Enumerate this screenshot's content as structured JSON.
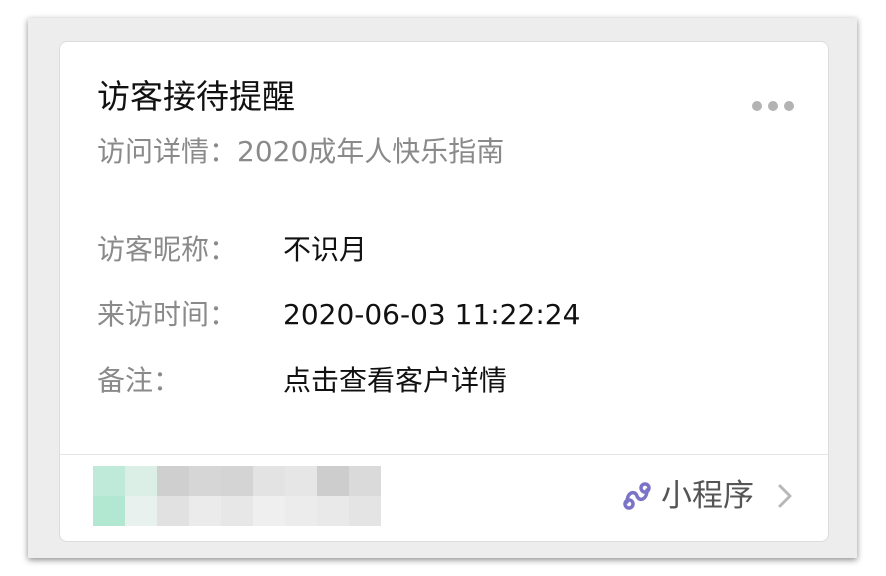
{
  "card": {
    "title": "访客接待提醒",
    "subtitle": "访问详情：2020成年人快乐指南",
    "more_icon": "more-horizontal-icon",
    "fields": [
      {
        "label": "访客昵称：",
        "value": "不识月"
      },
      {
        "label": "来访时间：",
        "value": "2020-06-03 11:22:24"
      },
      {
        "label": "备注：",
        "value": "点击查看客户详情"
      }
    ],
    "footer": {
      "mini_program_icon": "mini-program-link-icon",
      "mini_program_label": "小程序",
      "chevron_icon": "chevron-right-icon",
      "thumbnail": "blurred-image"
    }
  },
  "colors": {
    "accent": "#7b73c8",
    "label_gray": "#8a8a8a",
    "text_dark": "#111111"
  }
}
